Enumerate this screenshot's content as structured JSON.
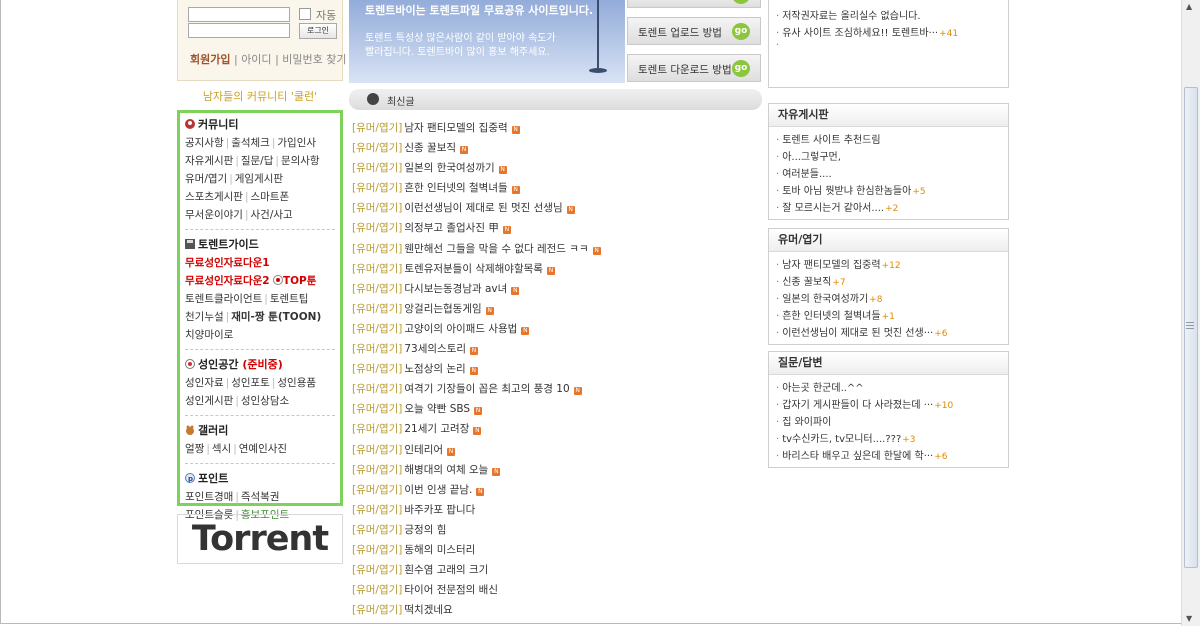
{
  "login": {
    "auto_label": "자동",
    "login_button": "로그인",
    "join_link": "회원가입",
    "find_id_link": "아이디",
    "find_pw_link": "비밀번호 찾기"
  },
  "slogan": "남자들의 커뮤니티 '쿨런'",
  "menu": {
    "community": {
      "title": "커뮤니티",
      "rows": [
        [
          "공지사항",
          "출석체크",
          "가입인사"
        ],
        [
          "자유게시판",
          "질문/답",
          "문의사항"
        ],
        [
          "유머/엽기",
          "게임게시판"
        ],
        [
          "스포츠게시판",
          "스마트폰"
        ],
        [
          "무서운이야기",
          "사건/사고"
        ]
      ]
    },
    "torrent_guide": {
      "title": "토렌트가이드",
      "red1": "무료성인자료다운1",
      "red2": "무료성인자료다운2",
      "top_badge": "TOP툰",
      "row3": [
        "토렌트클라이언트",
        "토렌트팁"
      ],
      "row4_a": "천기누설",
      "row4_b": "재미-짱 툰(TOON)",
      "row5": "치양마이로"
    },
    "adult": {
      "title": "성인공간",
      "pending": "(준비중)",
      "rows": [
        [
          "성인자료",
          "성인포토",
          "성인용품"
        ],
        [
          "성인게시판",
          "성인상담소"
        ]
      ]
    },
    "gallery": {
      "title": "갤러리",
      "rows": [
        [
          "얼짱",
          "섹시",
          "연예인사진"
        ]
      ]
    },
    "point": {
      "title": "포인트",
      "rows": [
        [
          "포인트경매",
          "즉석복권"
        ]
      ],
      "row2_a": "포인트슬롯",
      "row2_b": "홍보포인트"
    }
  },
  "torrent_logo": "Torrent",
  "banner": {
    "line1": "토렌트바이는 토렌트파일 무료공유 사이트입니다.",
    "line2": "토렌트 특성상 많은사람이 같이 받아야 속도가",
    "line3": "빨라집니다. 토렌트바이 많이 홍보 해주세요."
  },
  "guides": {
    "upload": "토렌트 업로드 방법",
    "download": "토렌트 다운로드 방법",
    "go": "go"
  },
  "recent": {
    "title": "최신글",
    "category": "[유머/엽기]",
    "posts": [
      {
        "title": "남자 팬티모델의 집중력",
        "new": true
      },
      {
        "title": "신종 꿀보직",
        "new": true
      },
      {
        "title": "일본의 한국여성까기",
        "new": true
      },
      {
        "title": "흔한 인터넷의 철벽녀들",
        "new": true
      },
      {
        "title": "이런선생님이 제대로 된 멋진 선생님",
        "new": true
      },
      {
        "title": "의정부고 졸업사진 甲",
        "new": true
      },
      {
        "title": "웬만해선 그들을 막을 수 없다 레전드 ㅋㅋ",
        "new": true
      },
      {
        "title": "토렌유저분들이 삭제해야할목록",
        "new": true
      },
      {
        "title": "다시보는동경남과 av녀",
        "new": true
      },
      {
        "title": "앙걸리는협동게임",
        "new": true
      },
      {
        "title": "고양이의 아이패드 사용법",
        "new": true
      },
      {
        "title": "73세의스토리",
        "new": true
      },
      {
        "title": "노점상의 논리",
        "new": true
      },
      {
        "title": "여격기 기장들이 꼽은 최고의 풍경 10",
        "new": true
      },
      {
        "title": "오늘 약빤 SBS",
        "new": true
      },
      {
        "title": "21세기 고려장",
        "new": true
      },
      {
        "title": "인테리어",
        "new": true
      },
      {
        "title": "해병대의 여체 오늘",
        "new": true
      },
      {
        "title": "이번 인생 끝남.",
        "new": true
      },
      {
        "title": "바주카포 팝니다",
        "new": false
      },
      {
        "title": "긍정의 힘",
        "new": false
      },
      {
        "title": "동해의 미스터리",
        "new": false
      },
      {
        "title": "흰수염 고래의 크기",
        "new": false
      },
      {
        "title": "타이어 전문점의 배신",
        "new": false
      },
      {
        "title": "떡치겠네요",
        "new": false
      }
    ]
  },
  "notice_box": {
    "items": [
      {
        "text": "저작권자료는 올리실수 없습니다.",
        "count": ""
      },
      {
        "text": "유사 사이트 조심하세요!! 토렌트바···",
        "count": "+41"
      }
    ]
  },
  "free_board": {
    "title": "자유게시판",
    "items": [
      {
        "text": "토렌트 사이트 추천드림",
        "count": ""
      },
      {
        "text": "아...그렇구먼,",
        "count": ""
      },
      {
        "text": "여러분들....",
        "count": ""
      },
      {
        "text": "토바 아님 뭣받냐 한심한놈들아",
        "count": "+5"
      },
      {
        "text": "잘 모르시는거 같아서....",
        "count": "+2"
      }
    ]
  },
  "humor_board": {
    "title": "유머/엽기",
    "items": [
      {
        "text": "남자 팬티모델의 집중력",
        "count": "+12"
      },
      {
        "text": "신종 꿀보직",
        "count": "+7"
      },
      {
        "text": "일본의 한국여성까기",
        "count": "+8"
      },
      {
        "text": "흔한 인터넷의 철벽녀들",
        "count": "+1"
      },
      {
        "text": "이런선생님이 제대로 된 멋진 선생···",
        "count": "+6"
      }
    ]
  },
  "qa_board": {
    "title": "질문/답변",
    "items": [
      {
        "text": "아는곳 한군데..^^",
        "count": ""
      },
      {
        "text": "갑자기 게시판들이 다 사라졌는데 ···",
        "count": "+10"
      },
      {
        "text": "집 와이파이",
        "count": ""
      },
      {
        "text": "tv수신카드, tv모니터....???",
        "count": "+3"
      },
      {
        "text": "바리스타 배우고 싶은데 한달에 학···",
        "count": "+6"
      }
    ]
  }
}
